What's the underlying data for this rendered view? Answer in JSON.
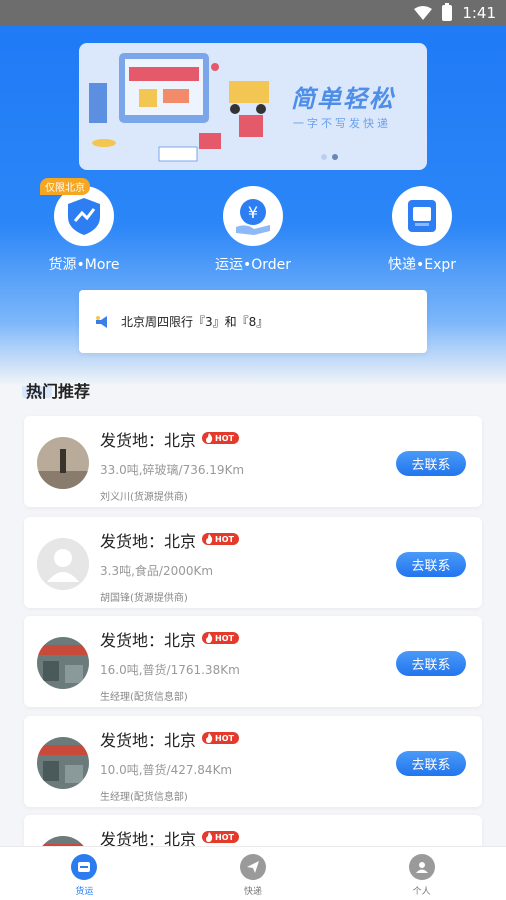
{
  "status_bar": {
    "time": "1:41"
  },
  "banner": {
    "slogan": "简单轻松",
    "subtitle": "一字不写发快递",
    "dots": 2,
    "active_dot": 2
  },
  "quick_actions": [
    {
      "label": "货源•More",
      "tag": "仅限北京",
      "icon": "chart-shield-icon"
    },
    {
      "label": "运运•Order",
      "icon": "yen-hand-icon"
    },
    {
      "label": "快递•Expr",
      "icon": "parcel-icon"
    }
  ],
  "notice": {
    "text": "北京周四限行『3』和『8』",
    "icon": "megaphone-icon"
  },
  "section": {
    "title": "热门推荐"
  },
  "cards": [
    {
      "origin": "发货地：北京",
      "hot": "HOT",
      "detail": "33.0吨,碎玻璃/736.19Km",
      "provider": "刘义川(货源提供商)",
      "button": "去联系",
      "avatar": "photo-person"
    },
    {
      "origin": "发货地：北京",
      "hot": "HOT",
      "detail": "3.3吨,食品/2000Km",
      "provider": "胡国锋(货源提供商)",
      "button": "去联系",
      "avatar": "default-avatar"
    },
    {
      "origin": "发货地：北京",
      "hot": "HOT",
      "detail": "16.0吨,普货/1761.38Km",
      "provider": "生经理(配货信息部)",
      "button": "去联系",
      "avatar": "photo-warehouse"
    },
    {
      "origin": "发货地：北京",
      "hot": "HOT",
      "detail": "10.0吨,普货/427.84Km",
      "provider": "生经理(配货信息部)",
      "button": "去联系",
      "avatar": "photo-warehouse"
    },
    {
      "origin": "发货地：北京",
      "hot": "HOT",
      "detail": "",
      "provider": "",
      "button": "",
      "avatar": "photo-warehouse"
    }
  ],
  "tabbar": [
    {
      "label": "货运",
      "icon": "cargo-icon",
      "active": true
    },
    {
      "label": "快递",
      "icon": "send-icon",
      "active": false
    },
    {
      "label": "个人",
      "icon": "person-icon",
      "active": false
    }
  ],
  "colors": {
    "primary": "#1f7bf6",
    "hot": "#e33a2b",
    "tag": "#f5a623"
  }
}
